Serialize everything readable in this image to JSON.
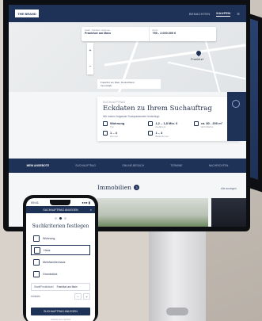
{
  "nav": {
    "logo": "THE BRAND",
    "links": [
      "BENACHTEN",
      "KAUFEN"
    ],
    "active_index": 1
  },
  "search": {
    "fields": [
      {
        "label": "Stadt, Stadtteil, Adresse ...",
        "value": "Frankfurt am Main"
      },
      {
        "label": "Preis",
        "value": "750 - 2.000.000 €"
      },
      {
        "label": "Stadt, Stadtteil",
        "value": "Frankfurt am Main"
      },
      {
        "label": "Preis",
        "value": "750 - 2.000.000 €"
      }
    ]
  },
  "map": {
    "zoom_in": "+",
    "zoom_out": "−",
    "city_label": "Frankfurt",
    "address_line1": "Frankfurt am Main, Deutschland",
    "address_line2": "Innenstadt"
  },
  "keycard": {
    "eyebrow": "SUCHAUFTRAG",
    "title": "Eckdaten zu Ihrem Suchauftrag",
    "subtitle": "Wir haben folgende Suchparameter hinterlegt:",
    "facts": [
      {
        "value": "Wohnung",
        "label": "Typ"
      },
      {
        "value": "1,2 – 1,8 Mio. €",
        "label": "Kaufpreis"
      },
      {
        "value": "ca. 80 - 200 m²",
        "label": "Wohnfläche"
      },
      {
        "value": "1 – 4",
        "label": "Zimmer"
      },
      {
        "value": "1 – 3",
        "label": "Badezimmer"
      }
    ]
  },
  "tabs": [
    "MEIN ANGEBOTE",
    "SUCHAUFTRAG",
    "ONLINE-BESUCH",
    "TERMINE",
    "NACHRICHTEN"
  ],
  "active_tab": 0,
  "listings": {
    "title": "Immobilien",
    "count": "3",
    "link": "Alle anzeigen"
  },
  "phone": {
    "time": "09:41",
    "signal": "●●● ▮",
    "header": "SUCHAUFTRAG ANLEGEN",
    "close": "×",
    "step": 2,
    "steps_total": 3,
    "title": "Suchkriterien festlegen",
    "options": [
      {
        "label": "Wohnung",
        "selected": false
      },
      {
        "label": "Haus",
        "selected": true
      },
      {
        "label": "Mehrfamilienhaus",
        "selected": false
      },
      {
        "label": "Grundstück",
        "selected": false
      }
    ],
    "location_label": "Stadt/Postleitzahl",
    "location_value": "Frankfurt am Main",
    "radius_label": "Umkreis",
    "radius_minus": "−",
    "radius_plus": "+",
    "cta": "SUCHAUFTRAG ANLEGEN",
    "cta_sub": "Zurück zum Schritt"
  },
  "colors": {
    "brand_navy": "#1e3156",
    "background": "#f5f6f8"
  }
}
